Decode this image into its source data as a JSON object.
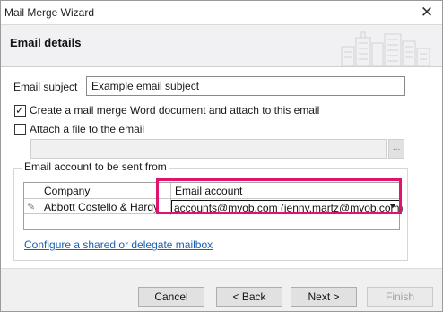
{
  "window": {
    "title": "Mail Merge Wizard"
  },
  "header": {
    "title": "Email details"
  },
  "form": {
    "subject_label": "Email subject",
    "subject_value": "Example email subject",
    "create_doc_label": "Create a mail merge Word document and attach to this email",
    "create_doc_checked": true,
    "attach_file_label": "Attach a file to the email",
    "attach_file_checked": false,
    "attach_file_value": "",
    "ellipsis": "..."
  },
  "account_group": {
    "legend": "Email account to be sent from",
    "columns": [
      "Company",
      "Email account"
    ],
    "rows": [
      {
        "company": "Abbott Costello & Hardy",
        "email_account": "accounts@myob.com (jenny.martz@myob.com)"
      }
    ],
    "delegate_link": "Configure a shared or delegate mailbox"
  },
  "buttons": {
    "cancel": "Cancel",
    "back": "< Back",
    "next": "Next >",
    "finish": "Finish"
  },
  "colors": {
    "highlight": "#e0146e",
    "link": "#1a5fb4"
  }
}
